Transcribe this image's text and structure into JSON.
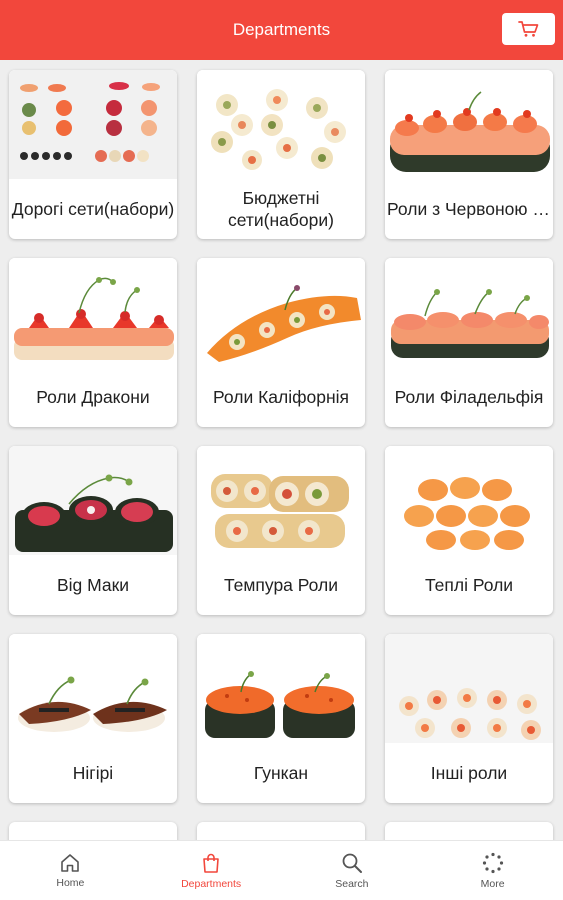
{
  "header": {
    "title": "Departments",
    "cart_icon": "cart-icon"
  },
  "categories": [
    {
      "label": "Дорогі сети(набори)",
      "thumb": "assorted-sets"
    },
    {
      "label": "Бюджетні сети(набори)",
      "thumb": "budget-sets"
    },
    {
      "label": "Роли з Червоною Ікрою",
      "thumb": "red-caviar-rolls"
    },
    {
      "label": "Роли Дракони",
      "thumb": "dragon-rolls"
    },
    {
      "label": "Роли Каліфорнія",
      "thumb": "california-rolls"
    },
    {
      "label": "Роли Філадельфія",
      "thumb": "philadelphia-rolls"
    },
    {
      "label": "Big Маки",
      "thumb": "big-maki"
    },
    {
      "label": "Темпура Роли",
      "thumb": "tempura-rolls"
    },
    {
      "label": "Теплі Роли",
      "thumb": "warm-rolls"
    },
    {
      "label": "Нігірі",
      "thumb": "nigiri"
    },
    {
      "label": "Гункан",
      "thumb": "gunkan"
    },
    {
      "label": "Інші роли",
      "thumb": "other-rolls"
    }
  ],
  "nav": [
    {
      "label": "Home",
      "icon": "home-icon",
      "active": false
    },
    {
      "label": "Departments",
      "icon": "shopping-bag-icon",
      "active": true
    },
    {
      "label": "Search",
      "icon": "search-icon",
      "active": false
    },
    {
      "label": "More",
      "icon": "more-icon",
      "active": false
    }
  ],
  "colors": {
    "accent": "#f2473c",
    "background": "#eeeeee",
    "card": "#ffffff"
  }
}
